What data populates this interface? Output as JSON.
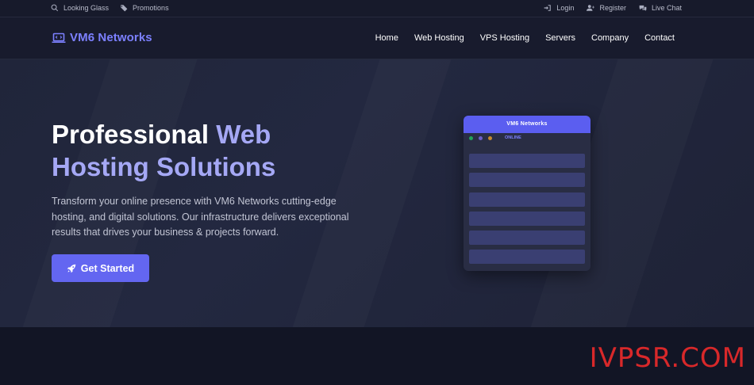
{
  "topbar": {
    "left": [
      {
        "label": "Looking Glass",
        "icon": "search-icon"
      },
      {
        "label": "Promotions",
        "icon": "tag-icon"
      }
    ],
    "right": [
      {
        "label": "Login",
        "icon": "login-icon"
      },
      {
        "label": "Register",
        "icon": "user-plus-icon"
      },
      {
        "label": "Live Chat",
        "icon": "chat-icon"
      }
    ]
  },
  "brand": {
    "name": "VM6 Networks",
    "icon": "laptop-icon",
    "color": "#7c80ff"
  },
  "nav": {
    "items": [
      "Home",
      "Web Hosting",
      "VPS Hosting",
      "Servers",
      "Company",
      "Contact"
    ]
  },
  "hero": {
    "title_part1": "Professional ",
    "title_accent1": "Web",
    "title_accent2": "Hosting Solutions",
    "description": "Transform your online presence with VM6 Networks cutting-edge hosting, and digital solutions. Our infrastructure delivers exceptional results that drives your business & projects forward.",
    "cta_label": "Get Started",
    "cta_icon": "rocket-icon"
  },
  "mockup": {
    "title": "VM6 Networks",
    "status": "ONLINE",
    "dot_colors": [
      "#22a35a",
      "#6c5fc9",
      "#c58a2e"
    ],
    "row_count": 6
  },
  "watermark": "IVPSR.COM",
  "colors": {
    "accent": "#6366f1",
    "background": "#181c2e"
  }
}
